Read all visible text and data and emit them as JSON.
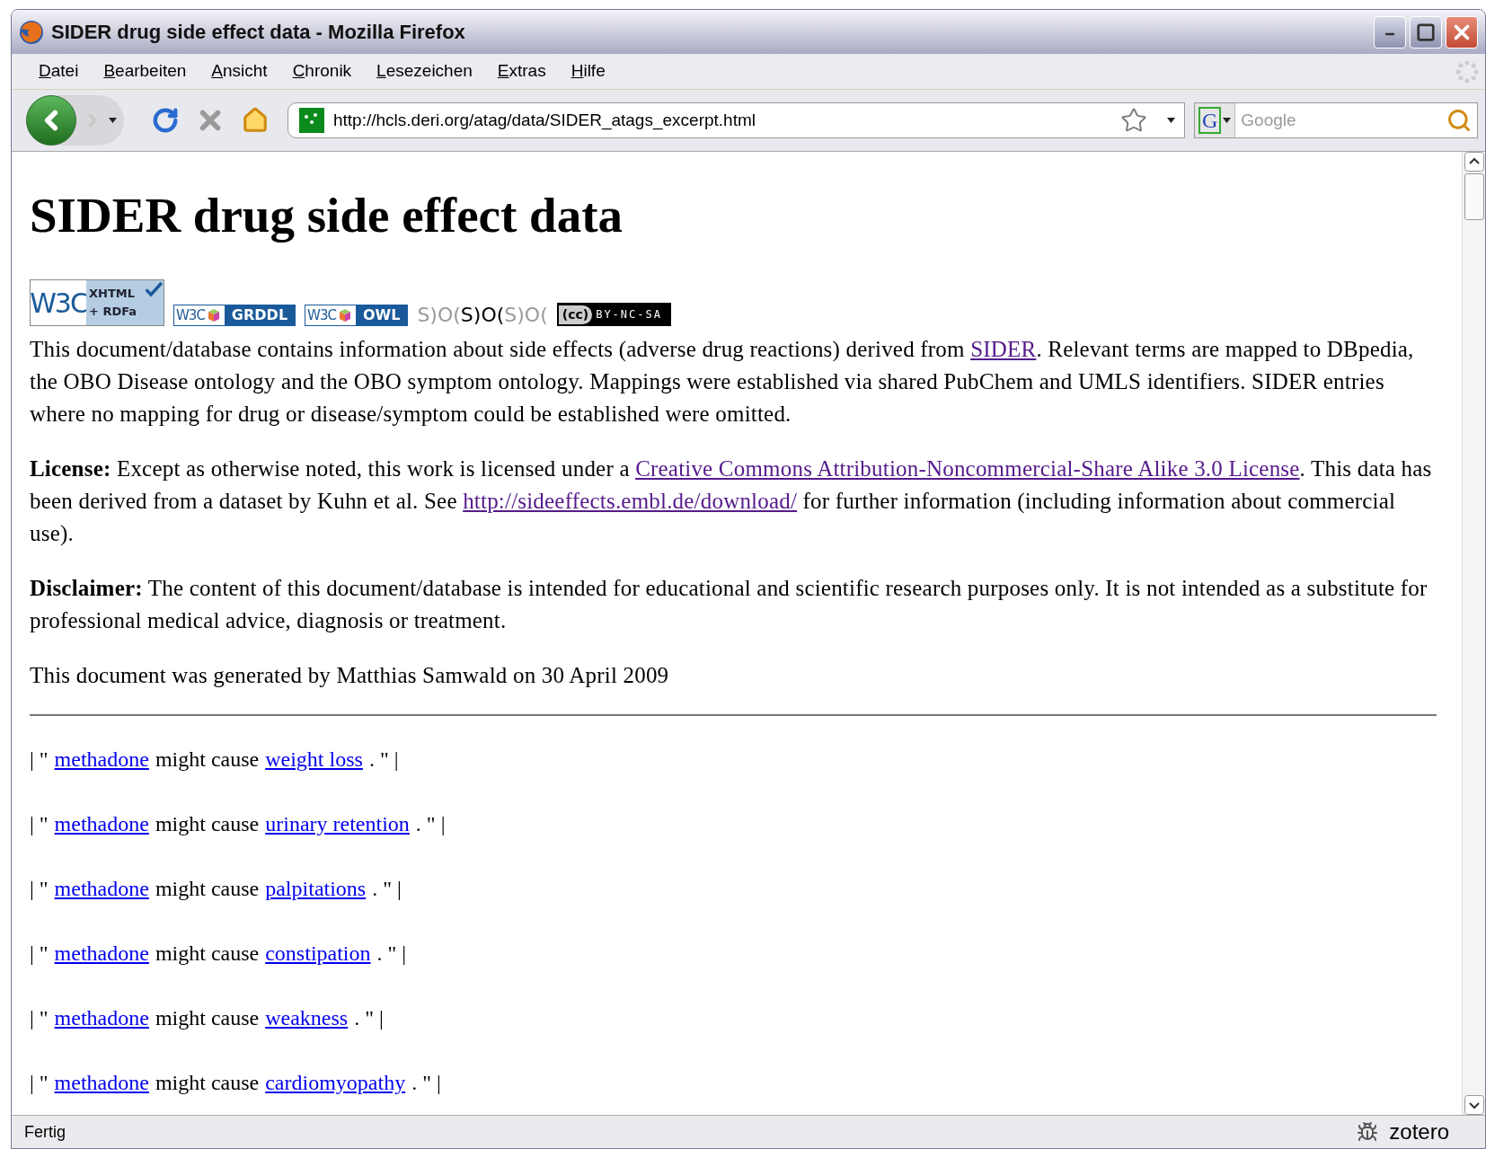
{
  "window": {
    "title": "SIDER drug side effect data - Mozilla Firefox"
  },
  "menu": [
    "Datei",
    "Bearbeiten",
    "Ansicht",
    "Chronik",
    "Lesezeichen",
    "Extras",
    "Hilfe"
  ],
  "navigation": {
    "url": "http://hcls.deri.org/atag/data/SIDER_atags_excerpt.html",
    "search_placeholder": "Google",
    "search_engine": "G"
  },
  "page": {
    "heading": "SIDER drug side effect data",
    "badges": [
      {
        "kind": "rdfa",
        "texts": [
          "W3C",
          "XHTML",
          "+ RDFa"
        ]
      },
      {
        "kind": "w3c",
        "texts": [
          "W3C",
          "GRDDL"
        ]
      },
      {
        "kind": "w3c",
        "texts": [
          "W3C",
          "OWL"
        ]
      },
      {
        "kind": "sioc",
        "texts": [
          "S)O(",
          "S)O(",
          "S)O("
        ]
      },
      {
        "kind": "cc",
        "texts": [
          "(cc)",
          "BY-NC-SA"
        ]
      }
    ],
    "paragraphs": [
      [
        {
          "kind": "text",
          "text": "This document/database contains information about side effects (adverse drug reactions) derived from "
        },
        {
          "kind": "link",
          "text": "SIDER",
          "visited": true
        },
        {
          "kind": "text",
          "text": ". Relevant terms are mapped to DBpedia, the OBO Disease ontology and the OBO symptom ontology. Mappings were established via shared PubChem and UMLS identifiers. SIDER entries where no mapping for drug or disease/symptom could be established were omitted."
        }
      ],
      [
        {
          "kind": "bold",
          "text": "License:"
        },
        {
          "kind": "text",
          "text": " Except as otherwise noted, this work is licensed under a "
        },
        {
          "kind": "link",
          "text": "Creative Commons Attribution-Noncommercial-Share Alike 3.0 License",
          "visited": true
        },
        {
          "kind": "text",
          "text": ". This data has been derived from a dataset by Kuhn et al. See "
        },
        {
          "kind": "link",
          "text": "http://sideeffects.embl.de/download/",
          "visited": true
        },
        {
          "kind": "text",
          "text": " for further information (including information about commercial use)."
        }
      ],
      [
        {
          "kind": "bold",
          "text": "Disclaimer:"
        },
        {
          "kind": "text",
          "text": " The content of this document/database is intended for educational and scientific research purposes only. It is not intended as a substitute for professional medical advice, diagnosis or treatment."
        }
      ],
      [
        {
          "kind": "text",
          "text": "This document was generated by Matthias Samwald on 30 April 2009"
        }
      ]
    ],
    "statements": [
      {
        "prefix": "| \"",
        "drug": "methadone",
        "verb": "might cause",
        "effect": "weight loss",
        "suffix": ". \" |"
      },
      {
        "prefix": "| \"",
        "drug": "methadone",
        "verb": "might cause",
        "effect": "urinary retention",
        "suffix": ". \" |"
      },
      {
        "prefix": "| \"",
        "drug": "methadone",
        "verb": "might cause",
        "effect": "palpitations",
        "suffix": ". \" |"
      },
      {
        "prefix": "| \"",
        "drug": "methadone",
        "verb": "might cause",
        "effect": "constipation",
        "suffix": ". \" |"
      },
      {
        "prefix": "| \"",
        "drug": "methadone",
        "verb": "might cause",
        "effect": "weakness",
        "suffix": ". \" |"
      },
      {
        "prefix": "| \"",
        "drug": "methadone",
        "verb": "might cause",
        "effect": "cardiomyopathy",
        "suffix": ". \" |"
      }
    ]
  },
  "status_bar": {
    "text": "Fertig",
    "addon": "zotero"
  }
}
